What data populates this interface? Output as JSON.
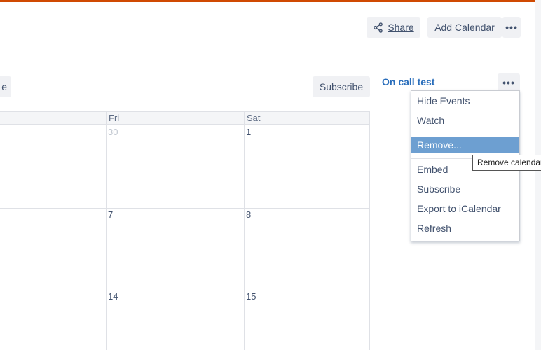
{
  "header": {
    "share_label": "Share",
    "add_calendar_label": "Add Calendar",
    "more_label": "•••",
    "accent_color": "#d04a02"
  },
  "toolbar": {
    "left_button_partial": "e",
    "subscribe_label": "Subscribe"
  },
  "calendar": {
    "day_headers": [
      "Fri",
      "Sat"
    ],
    "weeks": [
      {
        "fri": "30",
        "sat": "1"
      },
      {
        "fri": "7",
        "sat": "8"
      },
      {
        "fri": "14",
        "sat": "15"
      }
    ]
  },
  "sidebar": {
    "calendar_title": "On call test",
    "more_label": "•••",
    "title_color": "#2a6ebb"
  },
  "menu": {
    "items": [
      {
        "label": "Hide Events"
      },
      {
        "label": "Watch"
      },
      {
        "label": "Remove..."
      },
      {
        "label": "Embed"
      },
      {
        "label": "Subscribe"
      },
      {
        "label": "Export to iCalendar"
      },
      {
        "label": "Refresh"
      }
    ],
    "active_item": "Remove...",
    "active_color": "#6d9fd1"
  },
  "tooltip": {
    "text": "Remove calendar"
  }
}
